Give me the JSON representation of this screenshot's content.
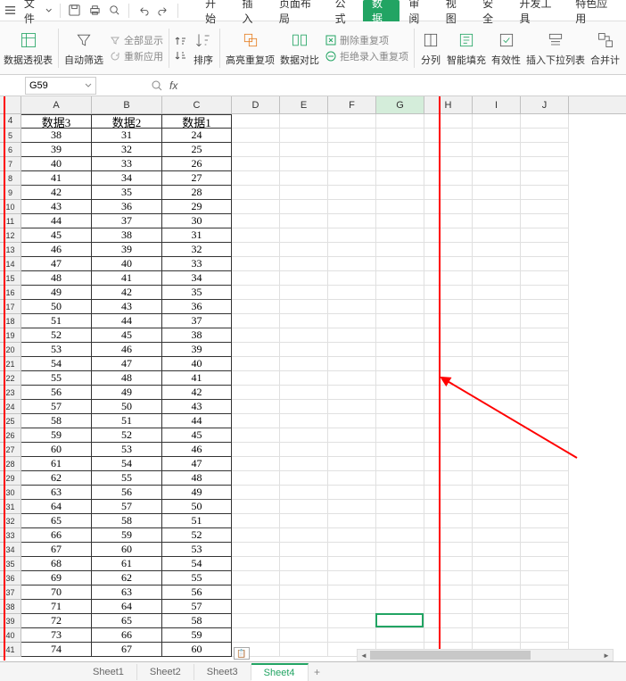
{
  "quickbar": {
    "file_label": "文件"
  },
  "tabs": {
    "items": [
      {
        "label": "开始"
      },
      {
        "label": "插入"
      },
      {
        "label": "页面布局"
      },
      {
        "label": "公式"
      },
      {
        "label": "数据"
      },
      {
        "label": "审阅"
      },
      {
        "label": "视图"
      },
      {
        "label": "安全"
      },
      {
        "label": "开发工具"
      },
      {
        "label": "特色应用"
      }
    ],
    "active_index": 4
  },
  "ribbon": {
    "pivot": "数据透视表",
    "autofilter": "自动筛选",
    "showall": "全部显示",
    "reapply": "重新应用",
    "sort": "排序",
    "highlight_dup": "高亮重复项",
    "data_compare": "数据对比",
    "remove_dup": "删除重复项",
    "reject_dup": "拒绝录入重复项",
    "text_to_col": "分列",
    "smart_fill": "智能填充",
    "validation": "有效性",
    "dropdown": "插入下拉列表",
    "consolidate": "合并计"
  },
  "formula_bar": {
    "cell_ref": "G59",
    "formula": ""
  },
  "columns": [
    {
      "label": "A",
      "width": 79
    },
    {
      "label": "B",
      "width": 79
    },
    {
      "label": "C",
      "width": 78
    },
    {
      "label": "D",
      "width": 54
    },
    {
      "label": "E",
      "width": 54
    },
    {
      "label": "F",
      "width": 54
    },
    {
      "label": "G",
      "width": 54
    },
    {
      "label": "H",
      "width": 54
    },
    {
      "label": "I",
      "width": 54
    },
    {
      "label": "J",
      "width": 54
    }
  ],
  "active_col_index": 6,
  "headers": [
    "数据3",
    "数据2",
    "数据1"
  ],
  "row_start": 4,
  "data_rows": [
    [
      38,
      31,
      24
    ],
    [
      39,
      32,
      25
    ],
    [
      40,
      33,
      26
    ],
    [
      41,
      34,
      27
    ],
    [
      42,
      35,
      28
    ],
    [
      43,
      36,
      29
    ],
    [
      44,
      37,
      30
    ],
    [
      45,
      38,
      31
    ],
    [
      46,
      39,
      32
    ],
    [
      47,
      40,
      33
    ],
    [
      48,
      41,
      34
    ],
    [
      49,
      42,
      35
    ],
    [
      50,
      43,
      36
    ],
    [
      51,
      44,
      37
    ],
    [
      52,
      45,
      38
    ],
    [
      53,
      46,
      39
    ],
    [
      54,
      47,
      40
    ],
    [
      55,
      48,
      41
    ],
    [
      56,
      49,
      42
    ],
    [
      57,
      50,
      43
    ],
    [
      58,
      51,
      44
    ],
    [
      59,
      52,
      45
    ],
    [
      60,
      53,
      46
    ],
    [
      61,
      54,
      47
    ],
    [
      62,
      55,
      48
    ],
    [
      63,
      56,
      49
    ],
    [
      64,
      57,
      50
    ],
    [
      65,
      58,
      51
    ],
    [
      66,
      59,
      52
    ],
    [
      67,
      60,
      53
    ],
    [
      68,
      61,
      54
    ],
    [
      69,
      62,
      55
    ],
    [
      70,
      63,
      56
    ],
    [
      71,
      64,
      57
    ],
    [
      72,
      65,
      58
    ],
    [
      73,
      66,
      59
    ],
    [
      74,
      67,
      60
    ]
  ],
  "active_cell": {
    "row_visible_index": 35,
    "col_index": 6
  },
  "sheets": {
    "items": [
      "Sheet1",
      "Sheet2",
      "Sheet3",
      "Sheet4"
    ],
    "active_index": 3
  },
  "colors": {
    "accent": "#22a463",
    "annotation": "#ff0000"
  }
}
